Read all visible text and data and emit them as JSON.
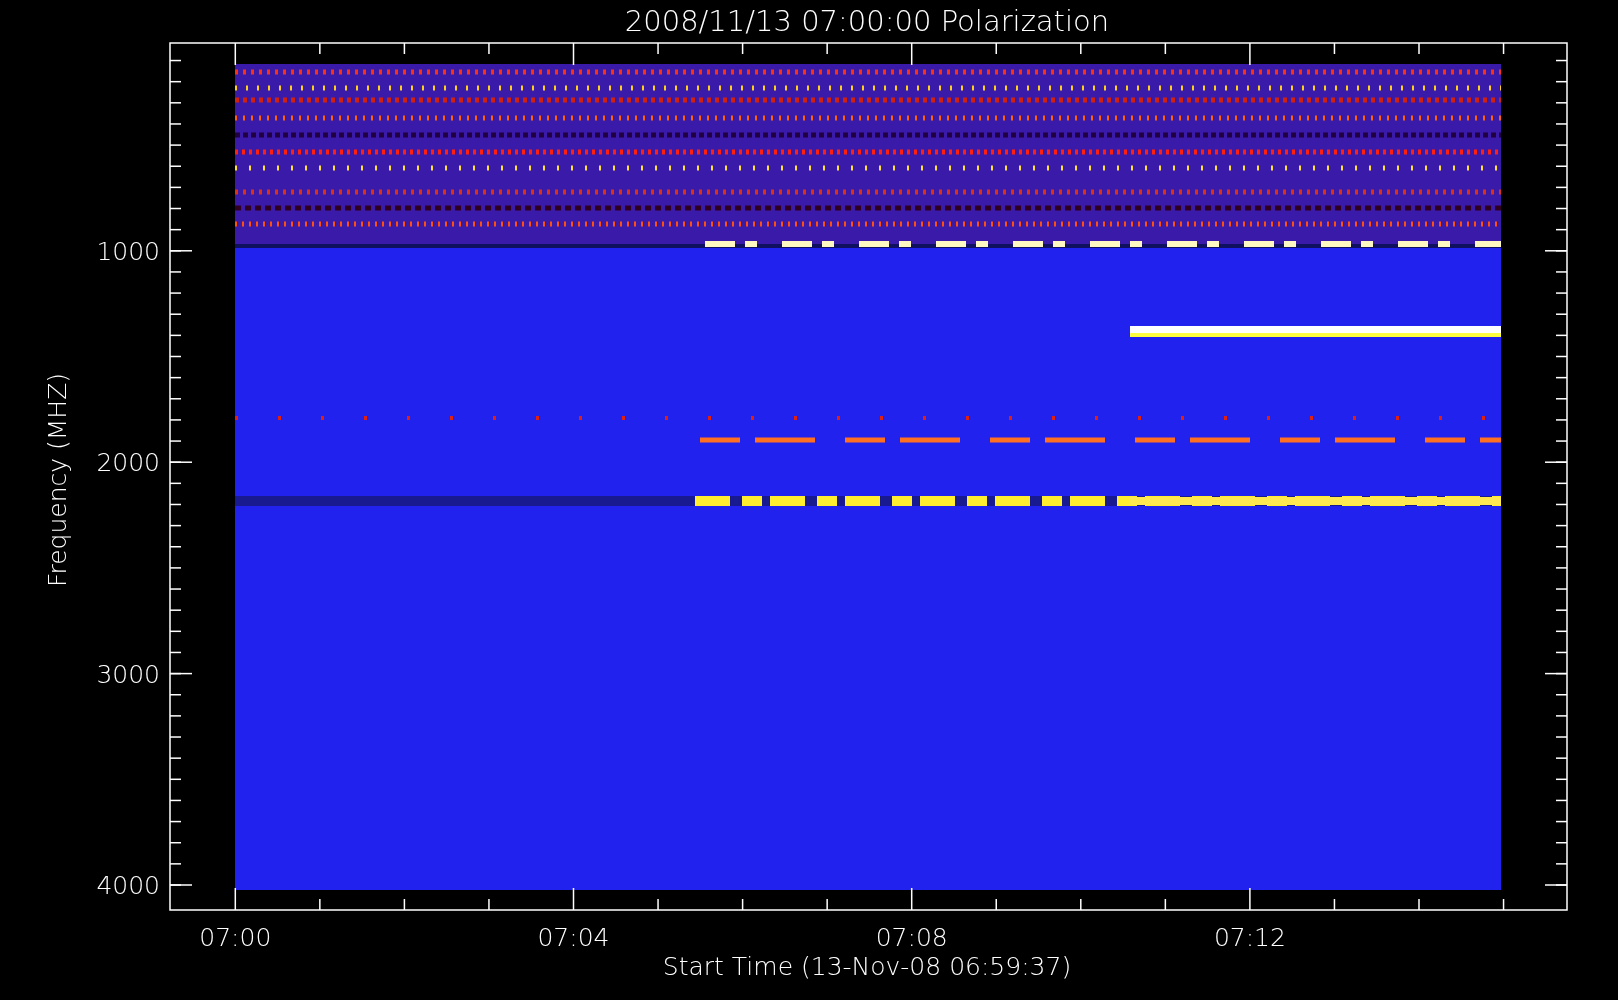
{
  "title": "2008/11/13 07:00:00 Polarization",
  "y_axis": {
    "label": "Frequency (MHZ)",
    "ticks": [
      "1000",
      "2000",
      "3000",
      "4000"
    ]
  },
  "x_axis": {
    "label": "Start Time (13-Nov-08 06:59:37)",
    "ticks": [
      "07:00",
      "07:04",
      "07:08",
      "07:12"
    ]
  }
}
